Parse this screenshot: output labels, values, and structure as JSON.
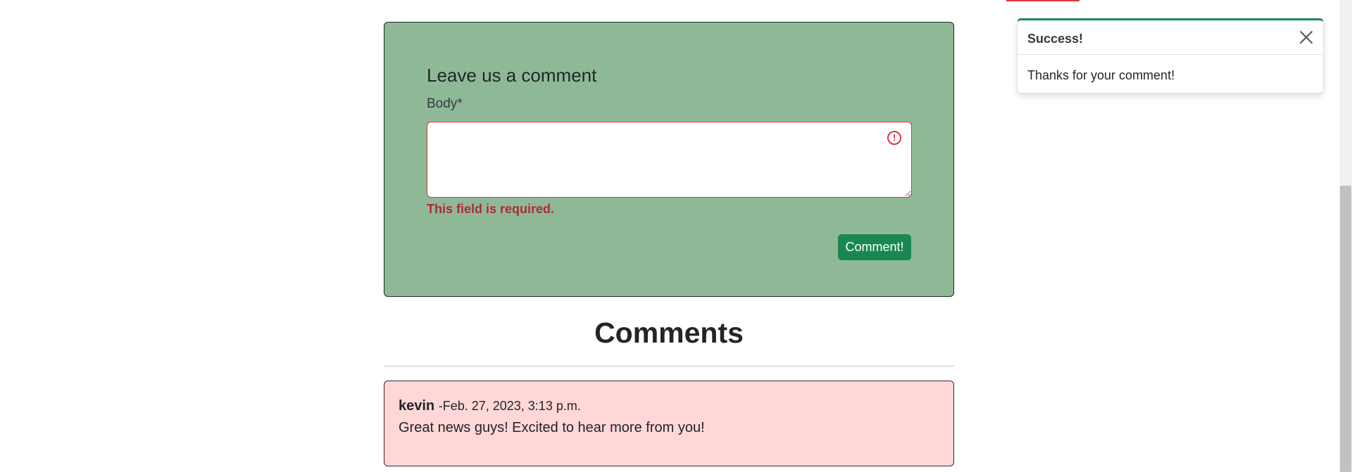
{
  "form": {
    "title": "Leave us a comment",
    "body_label": "Body*",
    "body_value": "",
    "error": "This field is required.",
    "error_icon": "exclamation-circle-icon",
    "submit_label": "Comment!"
  },
  "comments": {
    "heading": "Comments",
    "items": [
      {
        "author": "kevin",
        "date": "-Feb. 27, 2023, 3:13 p.m.",
        "body": "Great news guys! Excited to hear more from you!"
      }
    ]
  },
  "toast": {
    "title": "Success!",
    "message": "Thanks for your comment!",
    "close_icon": "close-icon"
  },
  "colors": {
    "form_bg": "#8fb996",
    "success": "#198754",
    "danger": "#dc3545",
    "comment_bg": "#ffd7d7"
  }
}
